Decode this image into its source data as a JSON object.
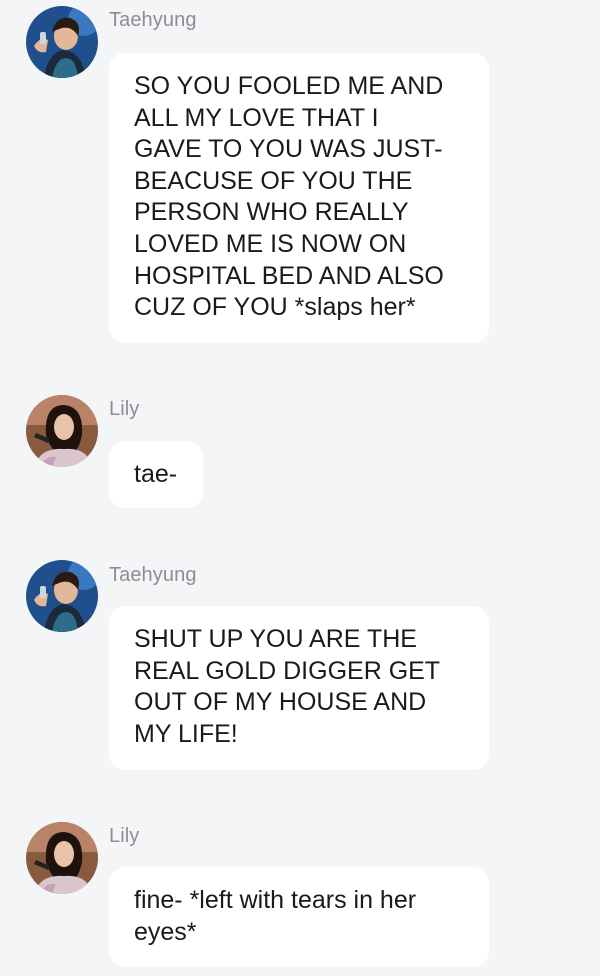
{
  "chat": {
    "messages": [
      {
        "sender": "Taehyung",
        "avatar": "taehyung-avatar",
        "text": "SO YOU FOOLED ME AND\nALL MY LOVE THAT I\nGAVE TO YOU WAS JUST-\nBEACUSE OF YOU THE\nPERSON WHO REALLY\nLOVED ME IS NOW ON\nHOSPITAL BED AND ALSO\nCUZ OF YOU *slaps her*"
      },
      {
        "sender": "Lily",
        "avatar": "lily-avatar",
        "text": "tae-"
      },
      {
        "sender": "Taehyung",
        "avatar": "taehyung-avatar",
        "text": "SHUT UP YOU ARE THE\nREAL GOLD DIGGER GET\nOUT OF MY HOUSE AND\nMY LIFE!"
      },
      {
        "sender": "Lily",
        "avatar": "lily-avatar",
        "text": "fine- *left with tears in her\neyes*"
      }
    ]
  },
  "colors": {
    "background": "#f4f5f7",
    "bubble": "#ffffff",
    "sender_name": "#8b8e94",
    "message_text": "#1a1a1a"
  }
}
